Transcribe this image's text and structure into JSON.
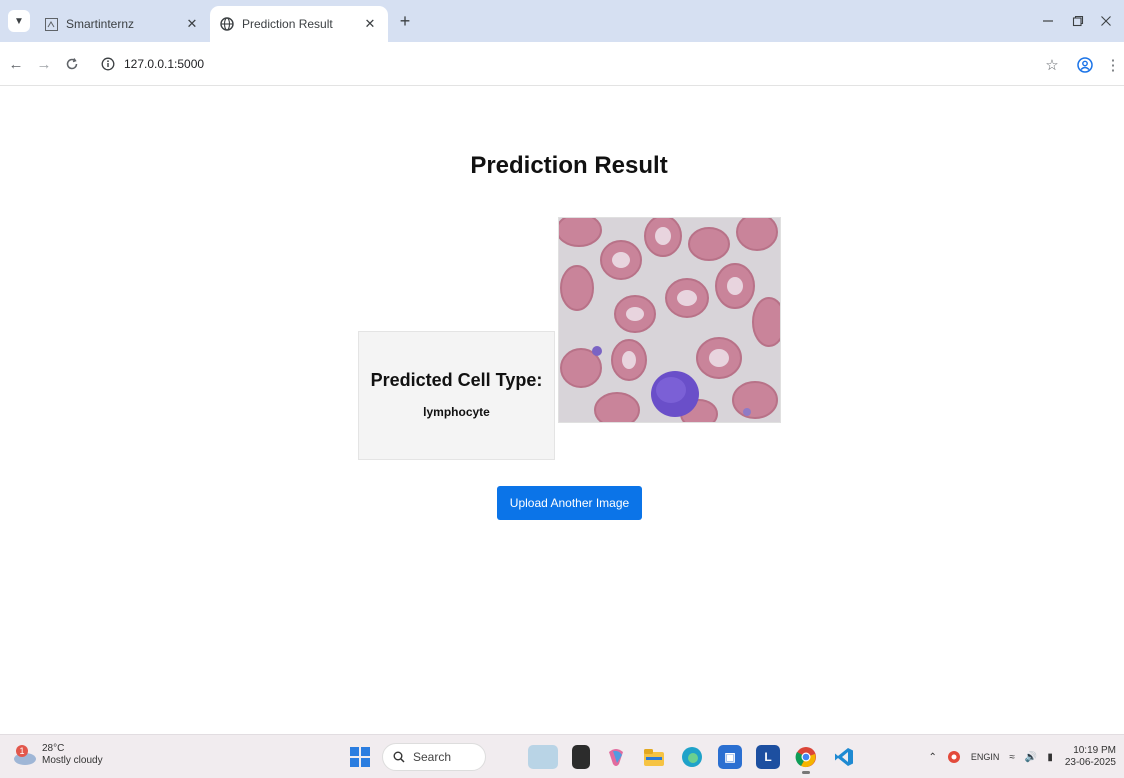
{
  "browser": {
    "tabs": [
      {
        "title": "Smartinternz",
        "favicon": "smartinternz-favicon",
        "active": false
      },
      {
        "title": "Prediction Result",
        "favicon": "globe-icon",
        "active": true
      }
    ],
    "new_tab_icon": "+",
    "address": "127.0.0.1:5000",
    "colors": {
      "tabstrip": "#d6e0f2",
      "accent": "#0b74e8"
    }
  },
  "page": {
    "heading": "Prediction Result",
    "card_label": "Predicted Cell Type:",
    "predicted_type": "lymphocyte",
    "upload_button": "Upload Another Image",
    "image_content": "blood-smear-cells"
  },
  "taskbar": {
    "weather": {
      "temp": "28°C",
      "condition": "Mostly cloudy",
      "badge": "1"
    },
    "search_placeholder": "Search",
    "language": {
      "line1": "ENG",
      "line2": "IN"
    },
    "clock": {
      "time": "10:19 PM",
      "date": "23-06-2025"
    }
  }
}
